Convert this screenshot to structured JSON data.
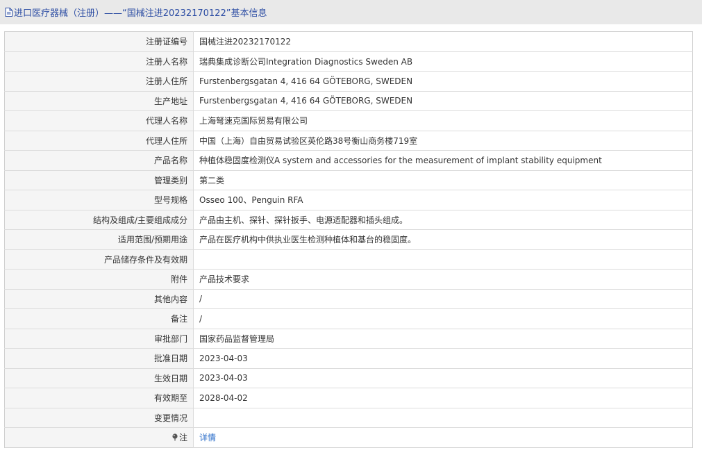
{
  "header": {
    "title": "进口医疗器械（注册）——“国械注进20232170122”基本信息"
  },
  "rows": [
    {
      "label": "注册证编号",
      "value": "国械注进20232170122"
    },
    {
      "label": "注册人名称",
      "value": "瑞典集成诊断公司Integration Diagnostics Sweden AB"
    },
    {
      "label": "注册人住所",
      "value": "Furstenbergsgatan 4, 416 64 GÖTEBORG, SWEDEN"
    },
    {
      "label": "生产地址",
      "value": "Furstenbergsgatan 4, 416 64 GÖTEBORG, SWEDEN"
    },
    {
      "label": "代理人名称",
      "value": "上海弩速克国际贸易有限公司"
    },
    {
      "label": "代理人住所",
      "value": "中国（上海）自由贸易试验区英伦路38号衡山商务楼719室"
    },
    {
      "label": "产品名称",
      "value": "种植体稳固度检测仪A system and accessories for the measurement of implant stability equipment"
    },
    {
      "label": "管理类别",
      "value": "第二类"
    },
    {
      "label": "型号规格",
      "value": "Osseo 100、Penguin RFA"
    },
    {
      "label": "结构及组成/主要组成成分",
      "value": "产品由主机、探针、探针扳手、电源适配器和插头组成。"
    },
    {
      "label": "适用范围/预期用途",
      "value": "产品在医疗机构中供执业医生检测种植体和基台的稳固度。"
    },
    {
      "label": "产品储存条件及有效期",
      "value": ""
    },
    {
      "label": "附件",
      "value": "产品技术要求"
    },
    {
      "label": "其他内容",
      "value": "/"
    },
    {
      "label": "备注",
      "value": "/"
    },
    {
      "label": "审批部门",
      "value": "国家药品监督管理局"
    },
    {
      "label": "批准日期",
      "value": "2023-04-03"
    },
    {
      "label": "生效日期",
      "value": "2023-04-03"
    },
    {
      "label": "有效期至",
      "value": "2028-04-02"
    },
    {
      "label": "变更情况",
      "value": ""
    }
  ],
  "note_row": {
    "label": "注",
    "link_text": "详情",
    "icon": "pin-icon"
  },
  "colors": {
    "title_bar_bg": "#e9e9e9",
    "title_text": "#2b4ca3",
    "label_bg": "#f5f5f5",
    "link": "#2b6ec9"
  }
}
